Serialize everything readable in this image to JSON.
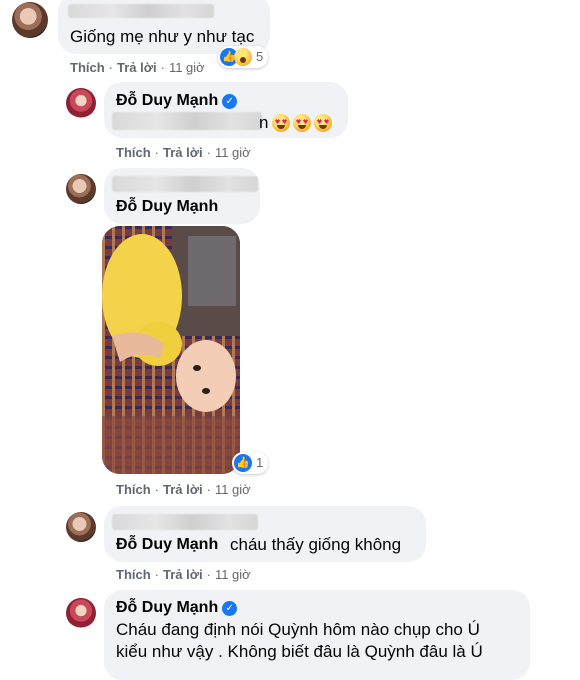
{
  "comments": [
    {
      "id": "c1",
      "text": "Giống mẹ như y như tạc",
      "reaction_count": "5",
      "actions": {
        "like": "Thích",
        "reply": "Trả lời",
        "time": "11 giờ"
      }
    },
    {
      "id": "c2",
      "author": "Đỗ Duy Mạnh",
      "text_suffix": "n",
      "emoji": [
        "heart-eyes-emoji",
        "heart-eyes-emoji",
        "heart-eyes-emoji"
      ],
      "actions": {
        "like": "Thích",
        "reply": "Trả lời",
        "time": "11 giờ"
      }
    },
    {
      "id": "c3",
      "author": "Đỗ Duy Mạnh",
      "reaction_count": "1",
      "actions": {
        "like": "Thích",
        "reply": "Trả lời",
        "time": "11 giờ"
      }
    },
    {
      "id": "c4",
      "author": "Đỗ Duy Mạnh",
      "text": "cháu thấy giống không",
      "actions": {
        "like": "Thích",
        "reply": "Trả lời",
        "time": "11 giờ"
      }
    },
    {
      "id": "c5",
      "author": "Đỗ Duy Mạnh",
      "line1": "Cháu đang định nói Quỳnh hôm nào chụp cho Ú",
      "line2": "kiểu như vậy . Không biết đâu là Quỳnh đâu là Ú"
    }
  ],
  "colors": {
    "like_blue": "#1877f2",
    "bubble": "#f0f2f5",
    "meta": "#65676b"
  },
  "icons": [
    "verified-badge-icon",
    "like-icon",
    "wow-icon"
  ]
}
